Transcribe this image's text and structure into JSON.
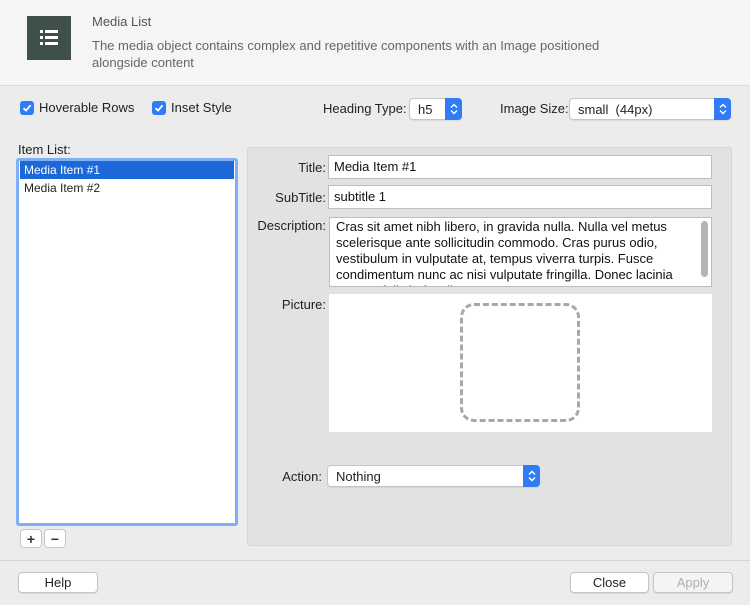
{
  "header": {
    "title": "Media List",
    "description": "The media object contains complex and repetitive components with an Image positioned alongside content",
    "icon": "list-icon"
  },
  "toolbar": {
    "hoverable_rows": {
      "label": "Hoverable Rows",
      "checked": true
    },
    "inset_style": {
      "label": "Inset Style",
      "checked": true
    },
    "heading_type": {
      "label": "Heading Type:",
      "value": "h5"
    },
    "image_size": {
      "label": "Image Size:",
      "value": "small  (44px)"
    }
  },
  "item_list": {
    "label": "Item List:",
    "items": [
      {
        "label": "Media Item #1",
        "selected": true
      },
      {
        "label": "Media Item #2",
        "selected": false
      }
    ],
    "add_label": "+",
    "remove_label": "−"
  },
  "detail": {
    "title_label": "Title:",
    "title_value": "Media Item #1",
    "subtitle_label": "SubTitle:",
    "subtitle_value": "subtitle 1",
    "description_label": "Description:",
    "description_value": "Cras sit amet nibh libero, in gravida nulla. Nulla vel metus scelerisque ante sollicitudin commodo. Cras purus odio, vestibulum in vulputate at, tempus viverra turpis. Fusce condimentum nunc ac nisi vulputate fringilla. Donec lacinia congue felis in faucibus.",
    "picture_label": "Picture:",
    "action_label": "Action:",
    "action_value": "Nothing"
  },
  "footer": {
    "help_label": "Help",
    "close_label": "Close",
    "apply_label": "Apply"
  },
  "colors": {
    "accent": "#2f7cf6",
    "selection": "#1c68d8",
    "header_icon_bg": "#3f4f4a"
  }
}
